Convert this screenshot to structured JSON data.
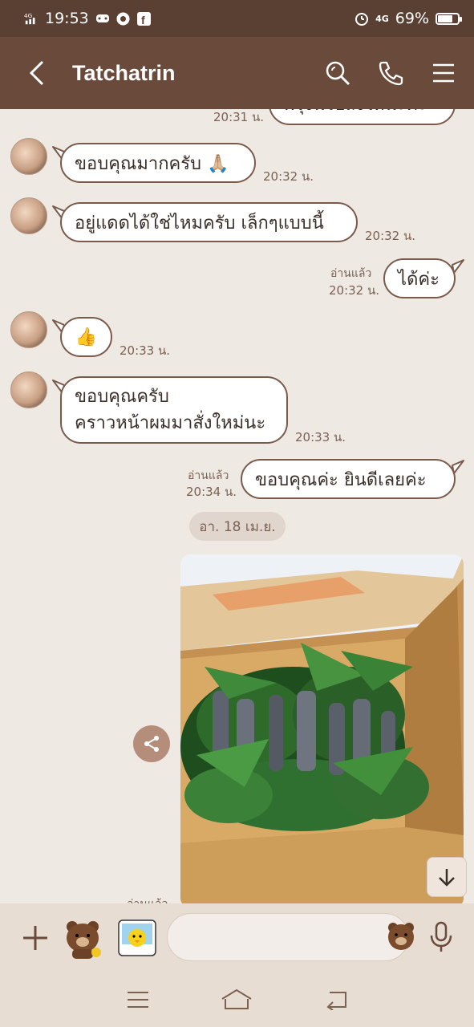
{
  "status_bar": {
    "network": "4G",
    "time": "19:53",
    "right_network": "4G",
    "battery": "69%",
    "battery_level": 0.69
  },
  "header": {
    "title": "Tatchatrin",
    "icons": [
      "back-icon",
      "search-icon",
      "phone-icon",
      "menu-icon"
    ]
  },
  "messages": [
    {
      "side": "right",
      "text": "พรุ่งนี้ไปส่งให้นะคะ",
      "time": "20:31 น."
    },
    {
      "side": "left",
      "text": "ขอบคุณมากครับ 🙏🏼",
      "time": "20:32 น."
    },
    {
      "side": "left",
      "text": "อยู่แดดได้ใช่ไหมครับ เล็กๆแบบนี้",
      "time": "20:32 น."
    },
    {
      "side": "right",
      "read": "อ่านแล้ว",
      "text": "ได้ค่ะ",
      "time": "20:32 น."
    },
    {
      "side": "left",
      "text": "👍",
      "time": "20:33 น."
    },
    {
      "side": "left",
      "lines": [
        "ขอบคุณครับ",
        "คราวหน้าผมมาสั่งใหม่นะ"
      ],
      "time": "20:33 น."
    },
    {
      "side": "right",
      "read": "อ่านแล้ว",
      "text": "ขอบคุณค่ะ ยินดีเลยค่ะ",
      "time": "20:34 น."
    }
  ],
  "date_divider": "อา. 18 เม.ย.",
  "last_read": "อ่านแล้ว",
  "input": {
    "placeholder": "",
    "value": ""
  },
  "colors": {
    "status_bar": "#5a4033",
    "header": "#6a4a3a",
    "background": "#efe9e3",
    "bubble_border": "#7a5a4b",
    "input_bar": "#e7ddd3"
  }
}
